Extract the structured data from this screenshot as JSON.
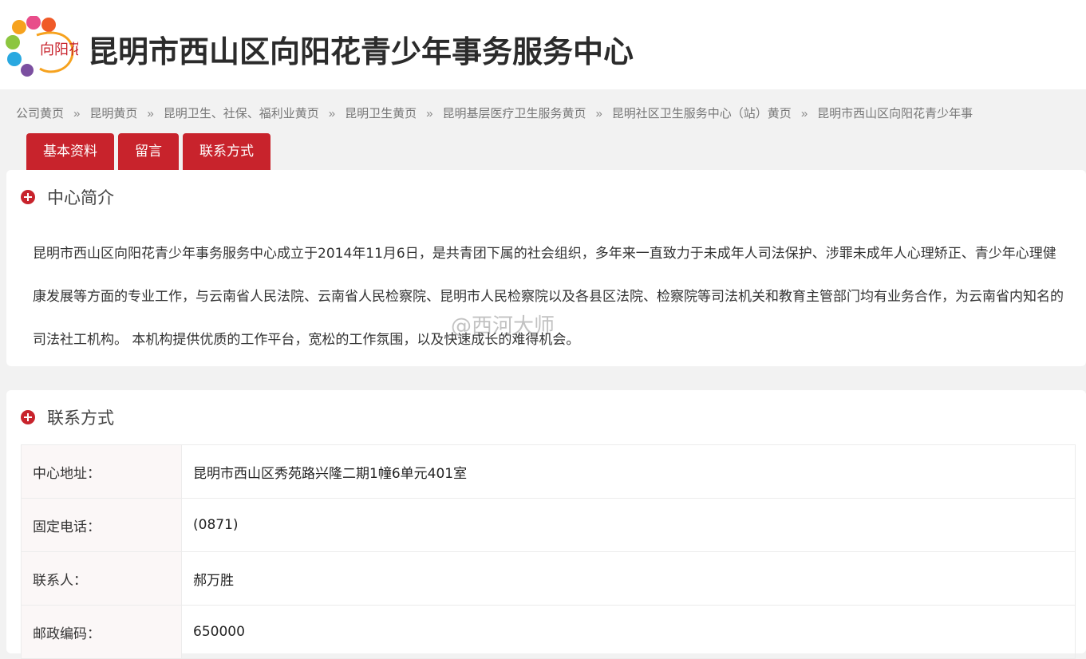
{
  "header": {
    "logo_text": "向阳花",
    "title": "昆明市西山区向阳花青少年事务服务中心"
  },
  "breadcrumb": [
    "公司黄页",
    "昆明黄页",
    "昆明卫生、社保、福利业黄页",
    "昆明卫生黄页",
    "昆明基层医疗卫生服务黄页",
    "昆明社区卫生服务中心（站）黄页",
    "昆明市西山区向阳花青少年事"
  ],
  "breadcrumb_sep": "»",
  "tabs": [
    {
      "label": "基本资料"
    },
    {
      "label": "留言"
    },
    {
      "label": "联系方式"
    }
  ],
  "intro": {
    "title": "中心简介",
    "text": "昆明市西山区向阳花青少年事务服务中心成立于2014年11月6日，是共青团下属的社会组织，多年来一直致力于未成年人司法保护、涉罪未成年人心理矫正、青少年心理健康发展等方面的专业工作，与云南省人民法院、云南省人民检察院、昆明市人民检察院以及各县区法院、检察院等司法机关和教育主管部门均有业务合作，为云南省内知名的司法社工机构。    本机构提供优质的工作平台，宽松的工作氛围，以及快速成长的难得机会。"
  },
  "watermark": "@西河大师",
  "contact": {
    "title": "联系方式",
    "rows": [
      {
        "label": "中心地址：",
        "value": "昆明市西山区秀苑路兴隆二期1幢6单元401室"
      },
      {
        "label": "固定电话：",
        "value": "(0871)"
      },
      {
        "label": "联系人：",
        "value": "郝万胜"
      },
      {
        "label": "邮政编码：",
        "value": "650000"
      }
    ]
  },
  "colors": {
    "accent": "#c8232c",
    "page_bg": "#f2f2f2",
    "label_bg": "#fbf7f7"
  }
}
